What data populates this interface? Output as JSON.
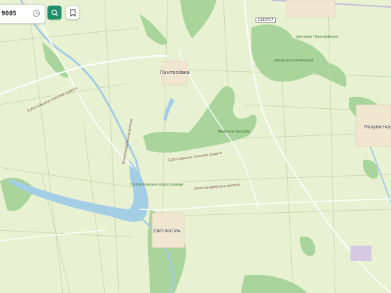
{
  "search": {
    "value": "9005"
  },
  "map": {
    "colors": {
      "land": "#e8f2d2",
      "forest": "#a9d49b",
      "river": "#a4cde6",
      "road": "#ffffff",
      "minor": "#c9c3b0"
    },
    "places": {
      "pantaziivka": "Пантазіївка",
      "svitlopil": "Світлопіль",
      "lozuvatka": "Лозуватка",
      "forest_tract": "Фаветна пасадба",
      "reservoir": "Світлопільське водосховище",
      "tract_n": "урочище Присадівське",
      "tract_ne": "урочище Сахнівщина"
    },
    "roads": {
      "shield": "С120717",
      "r1": "Суботцівська польова дорога",
      "r2": "Суботцівська польова дорога",
      "r3": "Олександрійська вулиця",
      "r4": "Олександрійська вулиця"
    }
  }
}
